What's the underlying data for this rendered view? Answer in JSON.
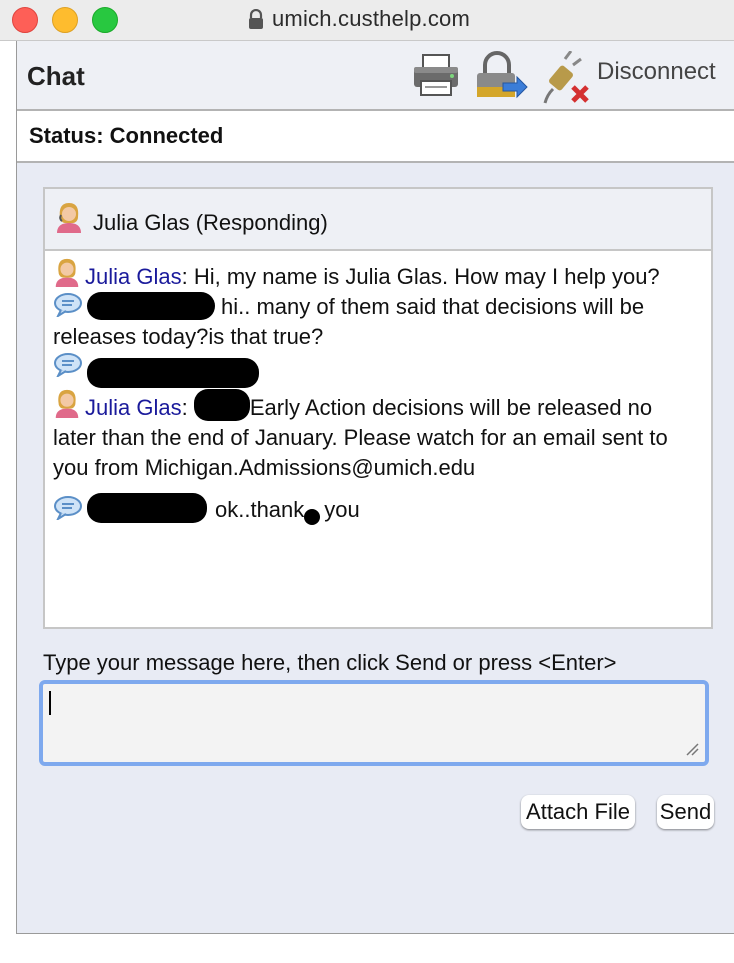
{
  "browser": {
    "url": "umich.custhelp.com"
  },
  "header": {
    "title": "Chat",
    "disconnect_label": "Disconnect"
  },
  "status": {
    "text": "Status: Connected"
  },
  "agent": {
    "heading": "Julia Glas (Responding)"
  },
  "messages": [
    {
      "sender": "Julia Glas",
      "type": "agent",
      "text": "Hi, my name is Julia Glas. How may I help you?"
    },
    {
      "sender": "",
      "type": "user",
      "text": "hi.. many of them said that decisions will be releases today?is that true?"
    },
    {
      "sender": "",
      "type": "user",
      "text": ""
    },
    {
      "sender": "Julia Glas",
      "type": "agent",
      "text": "Early Action decisions will be released no later than the end of January.  Please watch for an email sent to you from Michigan.Admissions@umich.edu"
    },
    {
      "sender": "",
      "type": "user",
      "text_a": "ok..thank",
      "text_b": "you"
    }
  ],
  "compose": {
    "prompt": "Type your message here, then click Send or press <Enter>",
    "value": ""
  },
  "buttons": {
    "attach": "Attach File",
    "send": "Send"
  },
  "colors": {
    "sender_name": "#1a1a9b",
    "focus_ring": "#7ea9ee",
    "frame_bg": "#e8ebf4"
  }
}
